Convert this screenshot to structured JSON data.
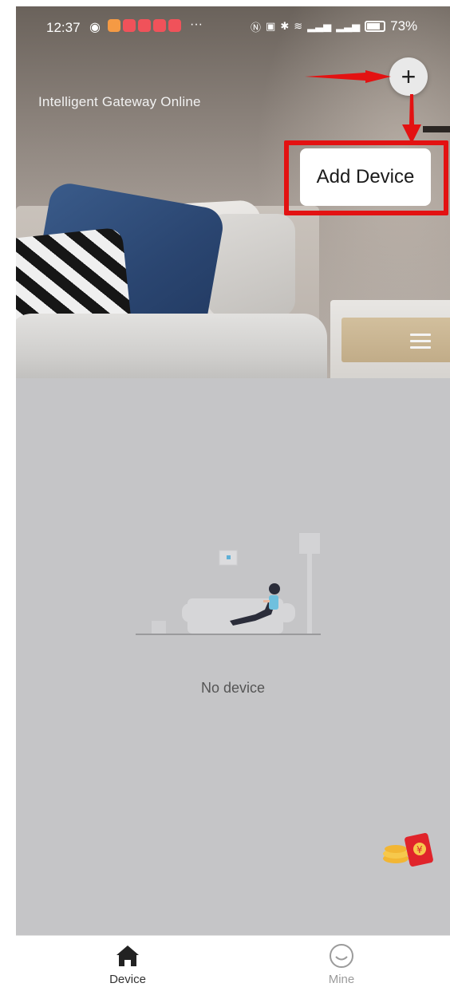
{
  "status_bar": {
    "time": "12:37",
    "more": "···",
    "battery": "73%"
  },
  "header": {
    "gateway_status": "Intelligent Gateway Online",
    "add_button_icon": "plus-icon",
    "menu_icon": "hamburger-menu-icon"
  },
  "popup": {
    "add_device_label": "Add Device"
  },
  "main": {
    "empty_text": "No device",
    "empty_illustration": "person-relaxing-on-sofa-illustration",
    "floating_icon": "red-packet-coins-icon"
  },
  "bottom_nav": {
    "items": [
      {
        "label": "Device",
        "icon": "home-icon"
      },
      {
        "label": "Mine",
        "icon": "smiley-icon"
      }
    ]
  },
  "colors": {
    "annotation_red": "#e31212",
    "content_bg": "#c5c5c7",
    "nav_active": "#333333",
    "nav_inactive": "#9b9b9b"
  }
}
